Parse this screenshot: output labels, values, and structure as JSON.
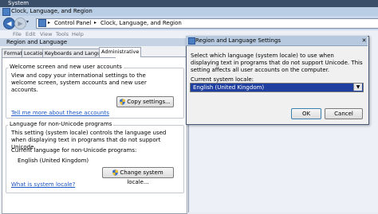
{
  "system_bar": {
    "title": "System"
  },
  "explorer": {
    "title": "Clock, Language, and Region",
    "address": {
      "root": "Control Panel",
      "separator": "▸",
      "current": "Clock, Language, and Region"
    },
    "menu": [
      "File",
      "Edit",
      "View",
      "Tools",
      "Help"
    ]
  },
  "region_dialog": {
    "title": "Region and Language",
    "tabs": [
      "Formats",
      "Location",
      "Keyboards and Languages",
      "Administrative"
    ],
    "welcome_group": {
      "title": "Welcome screen and new user accounts",
      "description": "View and copy your international settings to the welcome screen, system accounts and new user accounts.",
      "copy_button": "Copy settings...",
      "link": "Tell me more about these accounts"
    },
    "unicode_group": {
      "title": "Language for non-Unicode programs",
      "description": "This setting (system locale) controls the language used when displaying text in programs that do not support Unicode.",
      "current_label": "Current language for non-Unicode programs:",
      "current_value": "English (United Kingdom)",
      "change_button": "Change system locale...",
      "link": "What is system locale?"
    }
  },
  "settings_dialog": {
    "title": "Region and Language Settings",
    "description": "Select which language (system locale) to use when displaying text in programs that do not support Unicode. This setting affects all user accounts on the computer.",
    "locale_label": "Current system locale:",
    "locale_value": "English (United Kingdom)",
    "ok_label": "OK",
    "cancel_label": "Cancel"
  }
}
